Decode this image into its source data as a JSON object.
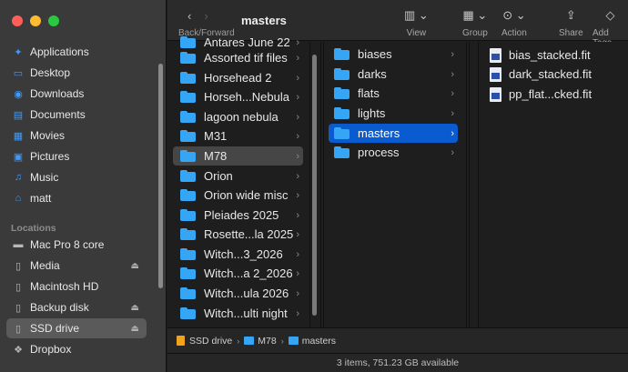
{
  "toolbar": {
    "title": "masters",
    "nav_label": "Back/Forward",
    "back_glyph": "‹",
    "forward_glyph": "›",
    "view_label": "View",
    "group_label": "Group",
    "action_label": "Action",
    "share_label": "Share",
    "add_tags_label": "Add Tags"
  },
  "sidebar": {
    "favorites": [
      {
        "label": "Applications",
        "icon": "applications-icon"
      },
      {
        "label": "Desktop",
        "icon": "desktop-icon"
      },
      {
        "label": "Downloads",
        "icon": "downloads-icon"
      },
      {
        "label": "Documents",
        "icon": "documents-icon"
      },
      {
        "label": "Movies",
        "icon": "movies-icon"
      },
      {
        "label": "Pictures",
        "icon": "pictures-icon"
      },
      {
        "label": "Music",
        "icon": "music-icon"
      },
      {
        "label": "matt",
        "icon": "home-icon"
      }
    ],
    "locations_heading": "Locations",
    "locations": [
      {
        "label": "Mac Pro 8 core",
        "icon": "computer-icon",
        "eject": false
      },
      {
        "label": "Media",
        "icon": "drive-icon",
        "eject": true
      },
      {
        "label": "Macintosh HD",
        "icon": "drive-icon",
        "eject": false
      },
      {
        "label": "Backup disk",
        "icon": "drive-icon",
        "eject": true
      },
      {
        "label": "SSD drive",
        "icon": "drive-icon",
        "eject": true,
        "selected": true
      },
      {
        "label": "Dropbox",
        "icon": "dropbox-icon",
        "eject": false
      }
    ],
    "partial_top_item": "Antares June 22"
  },
  "columns": {
    "col1": [
      "Antares June 22",
      "Assorted tif files",
      "Horsehead 2",
      "Horseh...Nebula",
      "lagoon nebula",
      "M31",
      "M78",
      "Orion",
      "Orion wide misc",
      "Pleiades 2025",
      "Rosette...la 2025",
      "Witch...3_2026",
      "Witch...a 2_2026",
      "Witch...ula 2026",
      "Witch...ulti night"
    ],
    "col1_selected": "M78",
    "col2": [
      "biases",
      "darks",
      "flats",
      "lights",
      "masters",
      "process"
    ],
    "col2_selected": "masters",
    "col3": [
      "bias_stacked.fit",
      "dark_stacked.fit",
      "pp_flat...cked.fit"
    ]
  },
  "pathbar": {
    "drive": "SSD drive",
    "folder1": "M78",
    "folder2": "masters"
  },
  "status": {
    "text": "3 items, 751.23 GB available"
  },
  "colors": {
    "accent": "#0a5bd0",
    "folder": "#35a6f5",
    "close": "#ff5f57",
    "minimize": "#febc2e",
    "maximize": "#28c840"
  }
}
